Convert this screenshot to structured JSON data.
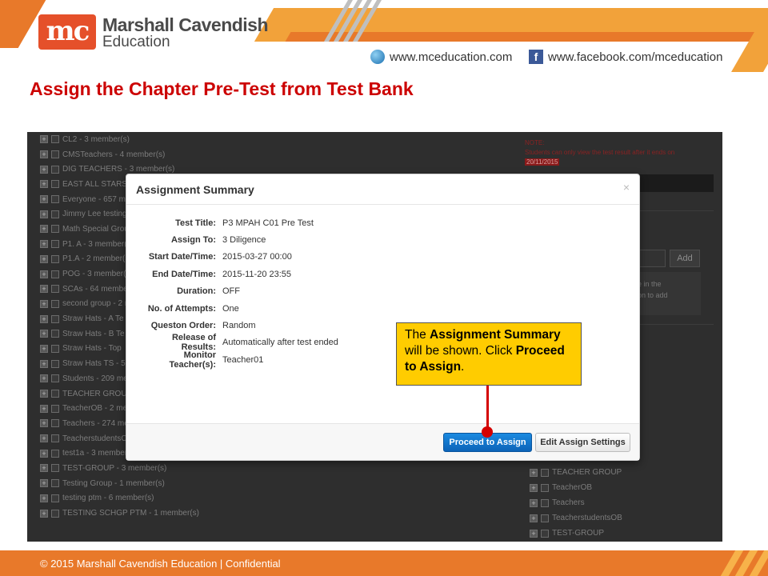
{
  "header": {
    "logo_mark": "mc",
    "logo_line1": "Marshall Cavendish",
    "logo_line2": "Education",
    "website": "www.mceducation.com",
    "facebook": "www.facebook.com/mceducation",
    "fb_glyph": "f",
    "icons": [
      "globe-icon",
      "facebook-icon"
    ]
  },
  "slide_title": "Assign the Chapter Pre-Test from Test Bank",
  "background_app": {
    "groups": [
      "CL2 - 3 member(s)",
      "CMSTeachers - 4 member(s)",
      "DIG TEACHERS - 3 member(s)",
      "EAST ALL STARS",
      "Everyone - 657 me",
      "Jimmy Lee testing",
      "Math Special Grou",
      "P1. A - 3 member(",
      "P1.A - 2 member(s",
      "POG - 3 member(s",
      "SCAs - 64 membe",
      "second group - 2 m",
      "Straw Hats - A Te",
      "Straw Hats - B Te",
      "Straw Hats - Top",
      "Straw Hats TS - 5",
      "Students - 209 me",
      "TEACHER GROU",
      "TeacherOB - 2 me",
      "Teachers - 274 me",
      "TeacherstudentsO",
      "test1a - 3 member",
      "TEST-GROUP - 3 member(s)",
      "Testing Group - 1 member(s)",
      "testing ptm - 6 member(s)",
      "TESTING SCHGP PTM - 1 member(s)"
    ],
    "note_label": "NOTE:",
    "note_text": "Students can only view the test result after it ends on",
    "note_date": "20/11/2015",
    "add_button": "Add",
    "hint_text_1": "ne in the",
    "hint_text_2": "tton to add",
    "right_groups": [
      "TEACHER GROUP",
      "TeacherOB",
      "Teachers",
      "TeacherstudentsOB",
      "TEST-GROUP"
    ]
  },
  "modal": {
    "title": "Assignment Summary",
    "close": "×",
    "fields": [
      {
        "label": "Test Title:",
        "value": "P3 MPAH C01 Pre Test"
      },
      {
        "label": "Assign To:",
        "value": "3 Diligence"
      },
      {
        "label": "Start Date/Time:",
        "value": "2015-03-27 00:00"
      },
      {
        "label": "End Date/Time:",
        "value": "2015-11-20 23:55"
      },
      {
        "label": "Duration:",
        "value": "OFF"
      },
      {
        "label": "No. of Attempts:",
        "value": "One"
      },
      {
        "label": "Queston Order:",
        "value": "Random"
      },
      {
        "label": "Release of Results:",
        "value": "Automatically after test ended"
      },
      {
        "label": "Monitor Teacher(s):",
        "value": "Teacher01"
      }
    ],
    "proceed_button": "Proceed to Assign",
    "edit_button": "Edit Assign Settings"
  },
  "callout": {
    "t1": "The ",
    "b1": "Assignment Summary",
    "t2": " will be shown. Click ",
    "b2": "Proceed to Assign",
    "t3": "."
  },
  "footer": {
    "text": "© 2015 Marshall Cavendish Education | Confidential"
  },
  "colors": {
    "brand_orange": "#e8792a",
    "title_red": "#cc0000",
    "callout_yellow": "#ffcc00",
    "primary_blue": "#0c63b8"
  }
}
